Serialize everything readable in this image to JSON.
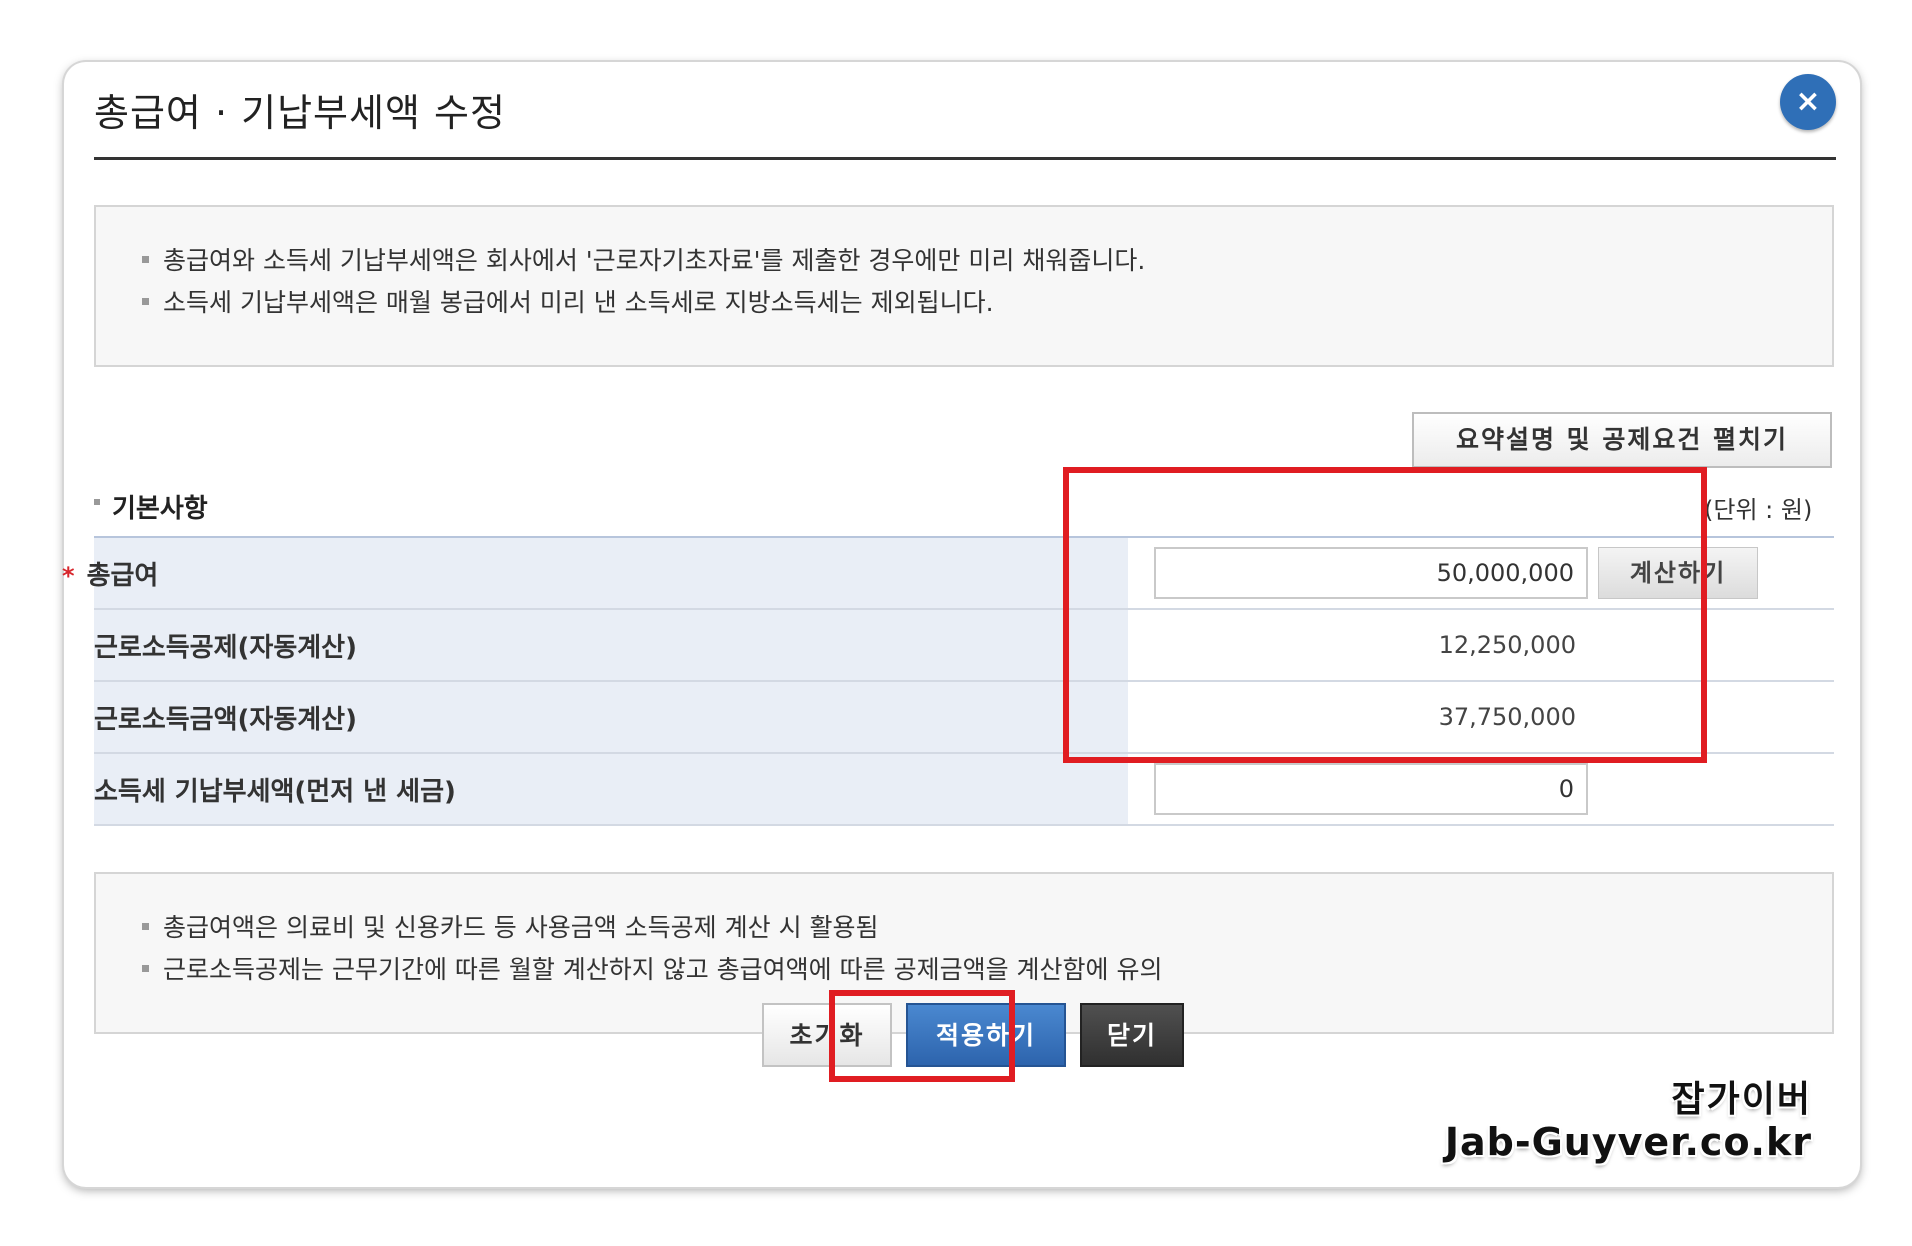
{
  "dialog": {
    "title": "총급여 · 기납부세액 수정",
    "close_label": "×"
  },
  "notice_top": {
    "items": [
      "총급여와 소득세 기납부세액은 회사에서 '근로자기초자료'를 제출한 경우에만 미리 채워줍니다.",
      "소득세 기납부세액은 매월 봉급에서 미리 낸 소득세로 지방소득세는 제외됩니다."
    ]
  },
  "summary_button_label": "요약설명 및 공제요건 펼치기",
  "section": {
    "title": "기본사항",
    "unit": "(단위 : 원)"
  },
  "rows": [
    {
      "label": "총급여",
      "required_mark": "*",
      "value": "50,000,000",
      "action_label": "계산하기"
    },
    {
      "label": "근로소득공제(자동계산)",
      "value": "12,250,000"
    },
    {
      "label": "근로소득금액(자동계산)",
      "value": "37,750,000"
    },
    {
      "label": "소득세 기납부세액(먼저 낸 세금)",
      "value": "0"
    }
  ],
  "notice_bottom": {
    "items": [
      "총급여액은 의료비 및 신용카드 등 사용금액 소득공제 계산 시 활용됨",
      "근로소득공제는 근무기간에 따른 월할 계산하지 않고 총급여액에 따른 공제금액을 계산함에 유의"
    ]
  },
  "buttons": {
    "reset": "초기화",
    "apply": "적용하기",
    "close": "닫기"
  },
  "watermark": {
    "line1": "잡가이버",
    "line2": "Jab-Guyver.co.kr"
  },
  "colors": {
    "accent_blue": "#2f6fb7",
    "highlight_red": "#e01d22",
    "label_bg": "#e9eef6"
  }
}
